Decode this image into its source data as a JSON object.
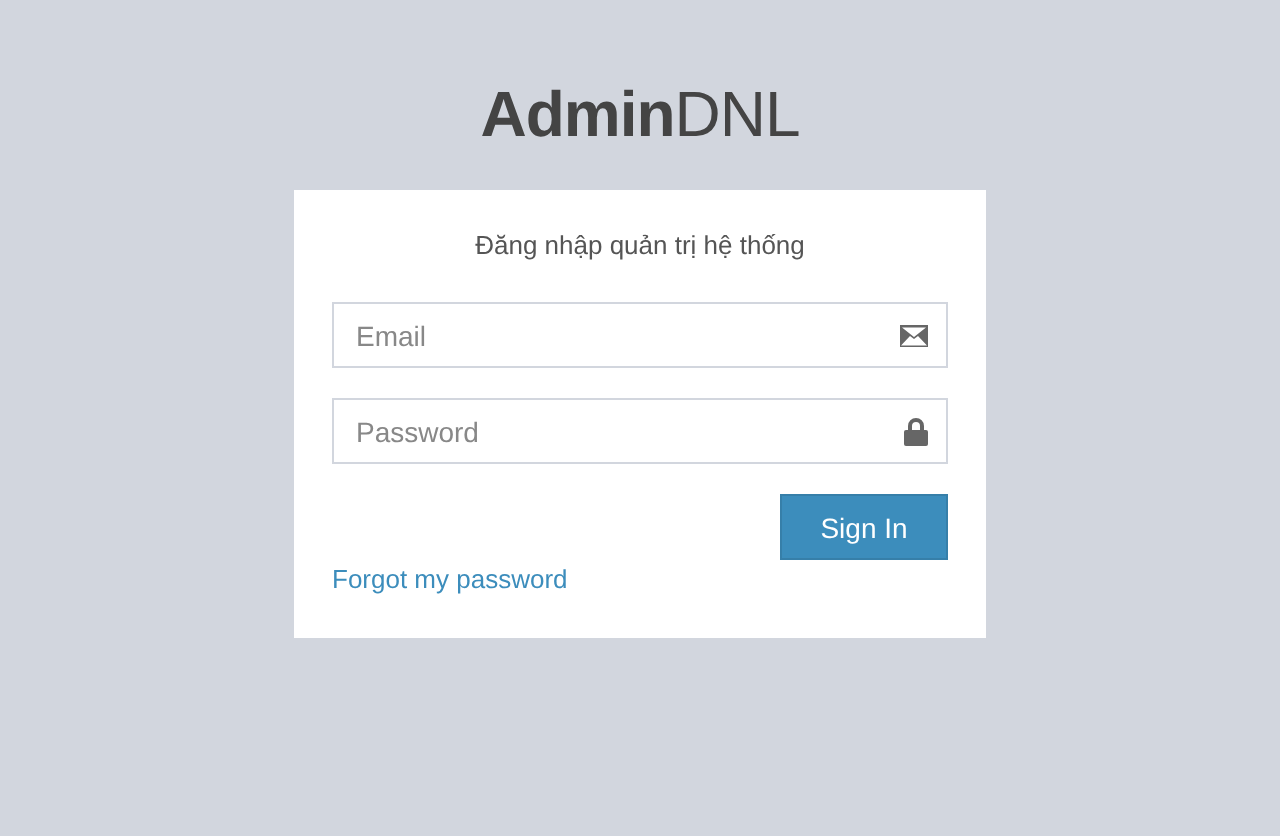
{
  "logo": "**Admin**DNL",
  "login_box": {
    "title": "Đăng nhập quản trị hệ thống",
    "fields": [
      {
        "kind": "email",
        "placeholder": "Email"
      },
      {
        "kind": "password",
        "placeholder": "Password"
      }
    ],
    "submit": "Sign In",
    "forgot_link": "Forgot my password"
  }
}
